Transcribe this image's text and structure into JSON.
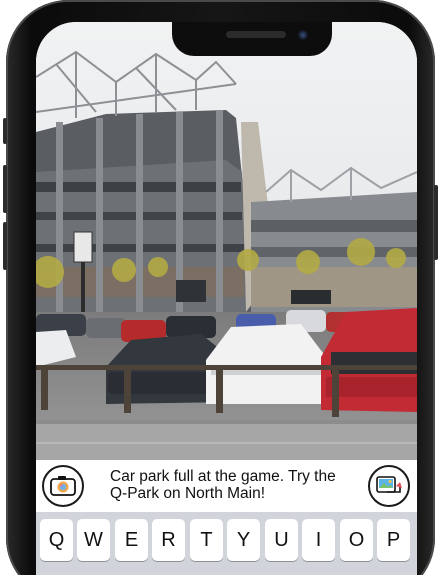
{
  "message": {
    "text_line1": "Car park full at the game. Try the",
    "text_line2": "Q-Park on North Main!"
  },
  "photo": {
    "description_icon": "stadium-car-park-photo"
  },
  "buttons": {
    "camera": "camera-icon",
    "send": "send-photo-icon"
  },
  "keyboard": {
    "keys": [
      "Q",
      "W",
      "E",
      "R",
      "T",
      "Y",
      "U",
      "I",
      "O",
      "P"
    ]
  },
  "colors": {
    "phone_frame": "#111111",
    "keyboard_bg": "#d1d4da",
    "key_bg": "#ffffff"
  }
}
